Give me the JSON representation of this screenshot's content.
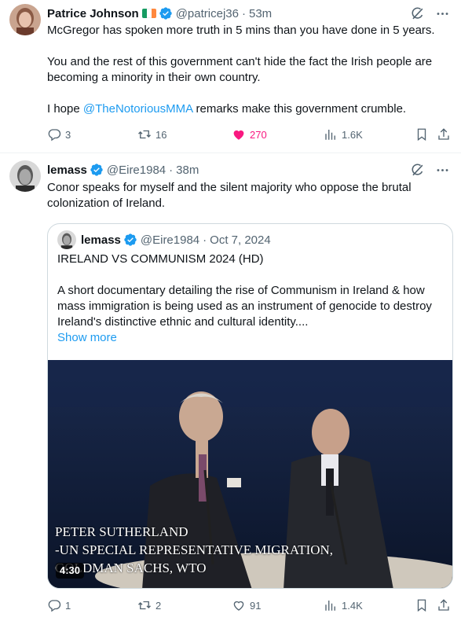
{
  "tweet1": {
    "name": "Patrice Johnson",
    "handle": "@patricej36",
    "time": "53m",
    "text_a": "McGregor has spoken more truth in 5 mins than you have done in 5 years.\n\nYou and the rest of this government can't hide the fact the Irish people are becoming a minority in their own country.\n\nI hope ",
    "mention": "@TheNotoriousMMA",
    "text_b": " remarks make this government crumble.",
    "replies": "3",
    "retweets": "16",
    "likes": "270",
    "views": "1.6K",
    "liked": true
  },
  "tweet2": {
    "name": "lemass",
    "handle": "@Eire1984",
    "time": "38m",
    "text": "Conor speaks for myself and the silent majority who oppose the brutal colonization of Ireland.",
    "replies": "1",
    "retweets": "2",
    "likes": "91",
    "views": "1.4K",
    "quote": {
      "name": "lemass",
      "handle": "@Eire1984",
      "date": "Oct 7, 2024",
      "text": "IRELAND VS COMMUNISM 2024 (HD)\n\nA short documentary detailing the rise of Communism in Ireland & how mass immigration is being used as an instrument of genocide to destroy Ireland's distinctive ethnic and cultural identity....",
      "show_more": "Show more",
      "video": {
        "caption_line1": "PETER SUTHERLAND",
        "caption_line2": "-UN SPECIAL REPRESENTATIVE MIGRATION,",
        "caption_line3": "GOLDMAN SACHS,  WTO",
        "duration": "4:30"
      }
    }
  },
  "separator": "·",
  "colors": {
    "accent": "#1d9bf0",
    "like": "#f91880",
    "muted": "#536471",
    "text": "#0f1419",
    "border": "#cfd9de",
    "verified": "#1d9bf0",
    "flag_green": "#169b62",
    "flag_white": "#ffffff",
    "flag_orange": "#ff883e"
  },
  "icons": [
    "grok-icon",
    "more-icon",
    "reply-icon",
    "retweet-icon",
    "heart-icon",
    "views-icon",
    "bookmark-icon",
    "share-icon",
    "verified-icon",
    "irish-flag-icon"
  ]
}
